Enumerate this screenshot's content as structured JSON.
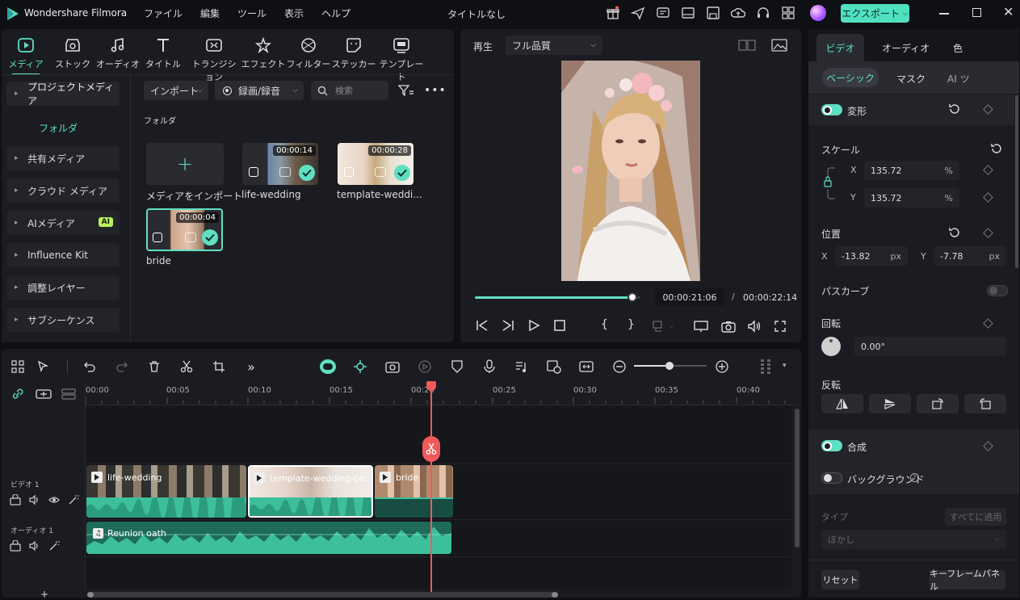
{
  "app": {
    "name": "Wondershare Filmora",
    "doc_title": "タイトルなし",
    "export_label": "エクスポート"
  },
  "menu": [
    "ファイル",
    "編集",
    "ツール",
    "表示",
    "ヘルプ"
  ],
  "media_tabs": [
    "メディア",
    "ストック",
    "オーディオ",
    "タイトル",
    "トランジション",
    "エフェクト",
    "フィルター",
    "ステッカー",
    "テンプレート"
  ],
  "sidebar": {
    "header": "プロジェクトメディア",
    "folder": "フォルダ",
    "items": [
      "共有メディア",
      "クラウド メディア",
      "AIメディア",
      "Influence Kit",
      "調整レイヤー",
      "サブシーケンス"
    ],
    "ai_badge": "AI"
  },
  "media_toolbar": {
    "import_label": "インポート",
    "record_label": "録画/録音",
    "search_placeholder": "検索"
  },
  "folder_label": "フォルダ",
  "media_items": [
    {
      "name": "メディアをインポート"
    },
    {
      "name": "life-wedding",
      "duration": "00:00:14"
    },
    {
      "name": "template-weddi...",
      "duration": "00:00:28"
    },
    {
      "name": "bride",
      "duration": "00:00:04"
    }
  ],
  "preview": {
    "play_label": "再生",
    "quality": "フル品質",
    "current_time": "00:00:21:06",
    "separator": "/",
    "total_time": "00:00:22:14",
    "progress": 0.95
  },
  "props": {
    "tabs": [
      "ビデオ",
      "オーディオ",
      "色"
    ],
    "subtabs": [
      "ベーシック",
      "マスク",
      "AI ツ"
    ],
    "transform": "変形",
    "scale": "スケール",
    "scale_x": "135.72",
    "scale_y": "135.72",
    "pct": "%",
    "x_label": "X",
    "y_label": "Y",
    "position": "位置",
    "pos_x": "-13.82",
    "pos_y": "-7.78",
    "px": "px",
    "path_curve": "パスカーブ",
    "rotation": "回転",
    "rotation_value": "0.00°",
    "flip": "反転",
    "composite": "合成",
    "background": "バックグラウンド",
    "type_label": "タイプ",
    "apply_all": "すべてに適用",
    "blur": "ぼかし",
    "reset": "リセット",
    "keyframe_panel": "キーフレームパネル"
  },
  "timeline": {
    "ticks": [
      "00:00",
      "00:05",
      "00:10",
      "00:15",
      "00:20",
      "00:25",
      "00:30",
      "00:35",
      "00:40"
    ],
    "video_track": "ビデオ 1",
    "audio_track": "オーディオ 1",
    "clips": [
      "life-wedding",
      "template-wedding-ce...",
      "bride"
    ],
    "audio_clip": "Reunion oath",
    "plus": "+"
  },
  "colors": {
    "accent": "#5fe0c2",
    "playhead": "#f05a5a",
    "export_bg": "#4fe0c0"
  }
}
